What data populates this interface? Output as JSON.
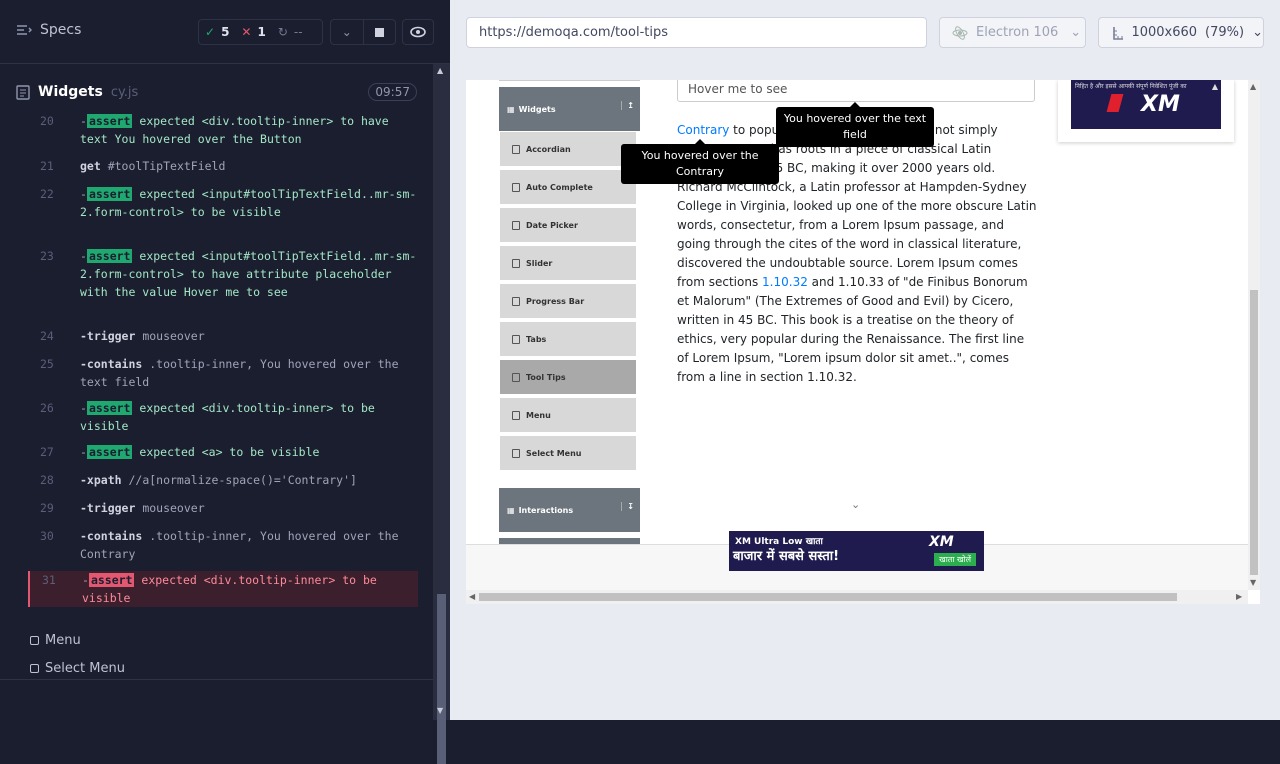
{
  "reporter": {
    "specs_label": "Specs",
    "stats": {
      "passed": "5",
      "failed": "1",
      "pending": "--"
    },
    "suite": {
      "title": "Widgets",
      "file": "cy.js",
      "time": "09:57"
    },
    "commands": [
      {
        "num": "20",
        "parts": [
          [
            "-",
            "dim"
          ],
          [
            "assert",
            "tag"
          ],
          [
            " expected <div.tooltip-inner> to have text ",
            "ok"
          ],
          [
            "You hovered over the Button",
            "ok"
          ]
        ]
      },
      {
        "num": "21",
        "parts": [
          [
            "get ",
            "kw"
          ],
          [
            "#toolTipTextField",
            "dim"
          ]
        ]
      },
      {
        "num": "22",
        "parts": [
          [
            "-",
            "dim"
          ],
          [
            "assert",
            "tag"
          ],
          [
            " expected <input#toolTipTextField..mr-sm-2.form-control> to be visible",
            "ok"
          ]
        ]
      },
      {
        "num": "23",
        "parts": [
          [
            "-",
            "dim"
          ],
          [
            "assert",
            "tag"
          ],
          [
            " expected <input#toolTipTextField..mr-sm-2.form-control> to have attribute placeholder with the value Hover me to see",
            "ok"
          ]
        ]
      },
      {
        "num": "24",
        "parts": [
          [
            "-trigger ",
            "kw"
          ],
          [
            "mouseover",
            "dim"
          ]
        ]
      },
      {
        "num": "25",
        "parts": [
          [
            "-contains ",
            "kw"
          ],
          [
            ".tooltip-inner, You hovered over the text field",
            "dim"
          ]
        ]
      },
      {
        "num": "26",
        "parts": [
          [
            "-",
            "dim"
          ],
          [
            "assert",
            "tag"
          ],
          [
            " expected <div.tooltip-inner> to be visible",
            "ok"
          ]
        ]
      },
      {
        "num": "27",
        "parts": [
          [
            "-",
            "dim"
          ],
          [
            "assert",
            "tag"
          ],
          [
            " expected <a> to be visible",
            "ok"
          ]
        ]
      },
      {
        "num": "28",
        "parts": [
          [
            "-xpath ",
            "kw"
          ],
          [
            "//a[normalize-space()='Contrary']",
            "dim"
          ]
        ]
      },
      {
        "num": "29",
        "parts": [
          [
            "-trigger ",
            "kw"
          ],
          [
            "mouseover",
            "dim"
          ]
        ]
      },
      {
        "num": "30",
        "parts": [
          [
            "-contains ",
            "kw"
          ],
          [
            ".tooltip-inner, You hovered over the Contrary",
            "dim"
          ]
        ]
      },
      {
        "num": "31",
        "parts": [
          [
            "-",
            "dim"
          ],
          [
            "assert",
            "tagr"
          ],
          [
            " expected <div.tooltip-inner> to be visible",
            "err"
          ]
        ]
      }
    ],
    "pending_tests": [
      "Menu",
      "Select Menu"
    ]
  },
  "browser": {
    "url": "https://demoqa.com/tool-tips",
    "engine": "Electron 106",
    "viewport": "1000x660",
    "zoom": "(79%)"
  },
  "app": {
    "nav_group": "Widgets",
    "nav_items": [
      "Accordian",
      "Auto Complete",
      "Date Picker",
      "Slider",
      "Progress Bar",
      "Tabs",
      "Tool Tips",
      "Menu",
      "Select Menu"
    ],
    "active_item": "Tool Tips",
    "nav_group2": "Interactions",
    "input_placeholder": "Hover me to see",
    "tooltip_text_field": "You hovered over the text field",
    "tooltip_contrary": "You hovered over the Contrary",
    "para": {
      "link1": "Contrary",
      "t1": " to popular belief, Lorem Ipsum is not simply random text. It has roots in a piece of classical Latin literature from 45 BC, making it over 2000 years old. Richard McClintock, a Latin professor at Hampden-Sydney College in Virginia, looked up one of the more obscure Latin words, consectetur, from a Lorem Ipsum passage, and going through the cites of the word in classical literature, discovered the undoubtable source. Lorem Ipsum comes from sections ",
      "link2": "1.10.32",
      "t2": " and 1.10.33 of \"de Finibus Bonorum et Malorum\" (The Extremes of Good and Evil) by Cicero, written in 45 BC. This book is a treatise on the theory of ethics, very popular during the Renaissance. The first line of Lorem Ipsum, \"Lorem ipsum dolor sit amet..\", comes from a line in section 1.10.32."
    },
    "ad_top_text": "निहित है और इससे आपकी संपूर्ण निवेशित पूंजी का",
    "ad_brand": "XM",
    "ad_bottom_line1": "XM Ultra Low खाता",
    "ad_bottom_line2": "बाजार में सबसे सस्ता!",
    "ad_bottom_cta": "खाता खोलें"
  },
  "colors": {
    "pass": "#1fa971",
    "fail": "#e45770",
    "reporter_bg": "#1b1e2e",
    "link": "#007bff"
  }
}
